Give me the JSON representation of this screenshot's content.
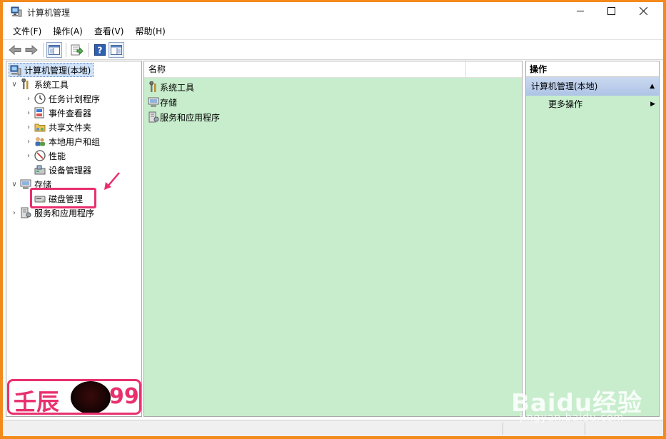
{
  "window": {
    "title": "计算机管理",
    "controls": {
      "minimize": "minimize-icon",
      "maximize": "maximize-icon",
      "close": "close-icon"
    }
  },
  "menu": [
    "文件(F)",
    "操作(A)",
    "查看(V)",
    "帮助(H)"
  ],
  "toolbar": [
    "back-arrow-icon",
    "forward-arrow-icon",
    "show-hide-tree-icon",
    "export-list-icon",
    "help-icon",
    "show-hide-action-pane-icon"
  ],
  "tree": {
    "root": "计算机管理(本地)",
    "items": [
      {
        "label": "系统工具",
        "icon": "tools-icon",
        "expanded": true
      },
      {
        "label": "任务计划程序",
        "icon": "clock-icon"
      },
      {
        "label": "事件查看器",
        "icon": "event-viewer-icon"
      },
      {
        "label": "共享文件夹",
        "icon": "shared-folder-icon"
      },
      {
        "label": "本地用户和组",
        "icon": "users-icon"
      },
      {
        "label": "性能",
        "icon": "performance-icon"
      },
      {
        "label": "设备管理器",
        "icon": "device-manager-icon"
      },
      {
        "label": "存储",
        "icon": "storage-icon",
        "expanded": true
      },
      {
        "label": "磁盘管理",
        "icon": "disk-icon"
      },
      {
        "label": "服务和应用程序",
        "icon": "services-icon"
      }
    ]
  },
  "list": {
    "column_header": "名称",
    "items": [
      {
        "label": "系统工具",
        "icon": "tools-icon"
      },
      {
        "label": "存储",
        "icon": "storage-icon"
      },
      {
        "label": "服务和应用程序",
        "icon": "services-icon"
      }
    ]
  },
  "actions": {
    "header": "操作",
    "group": "计算机管理(本地)",
    "item": "更多操作"
  },
  "watermarks": {
    "logo_left": "壬辰",
    "logo_right": "99",
    "baidu_brand": "Baidu经验",
    "baidu_url": "jingyan.baidu.com"
  },
  "colors": {
    "frame": "#f38a1c",
    "highlight": "#e8306e",
    "pane_bg": "#c7edcc"
  }
}
